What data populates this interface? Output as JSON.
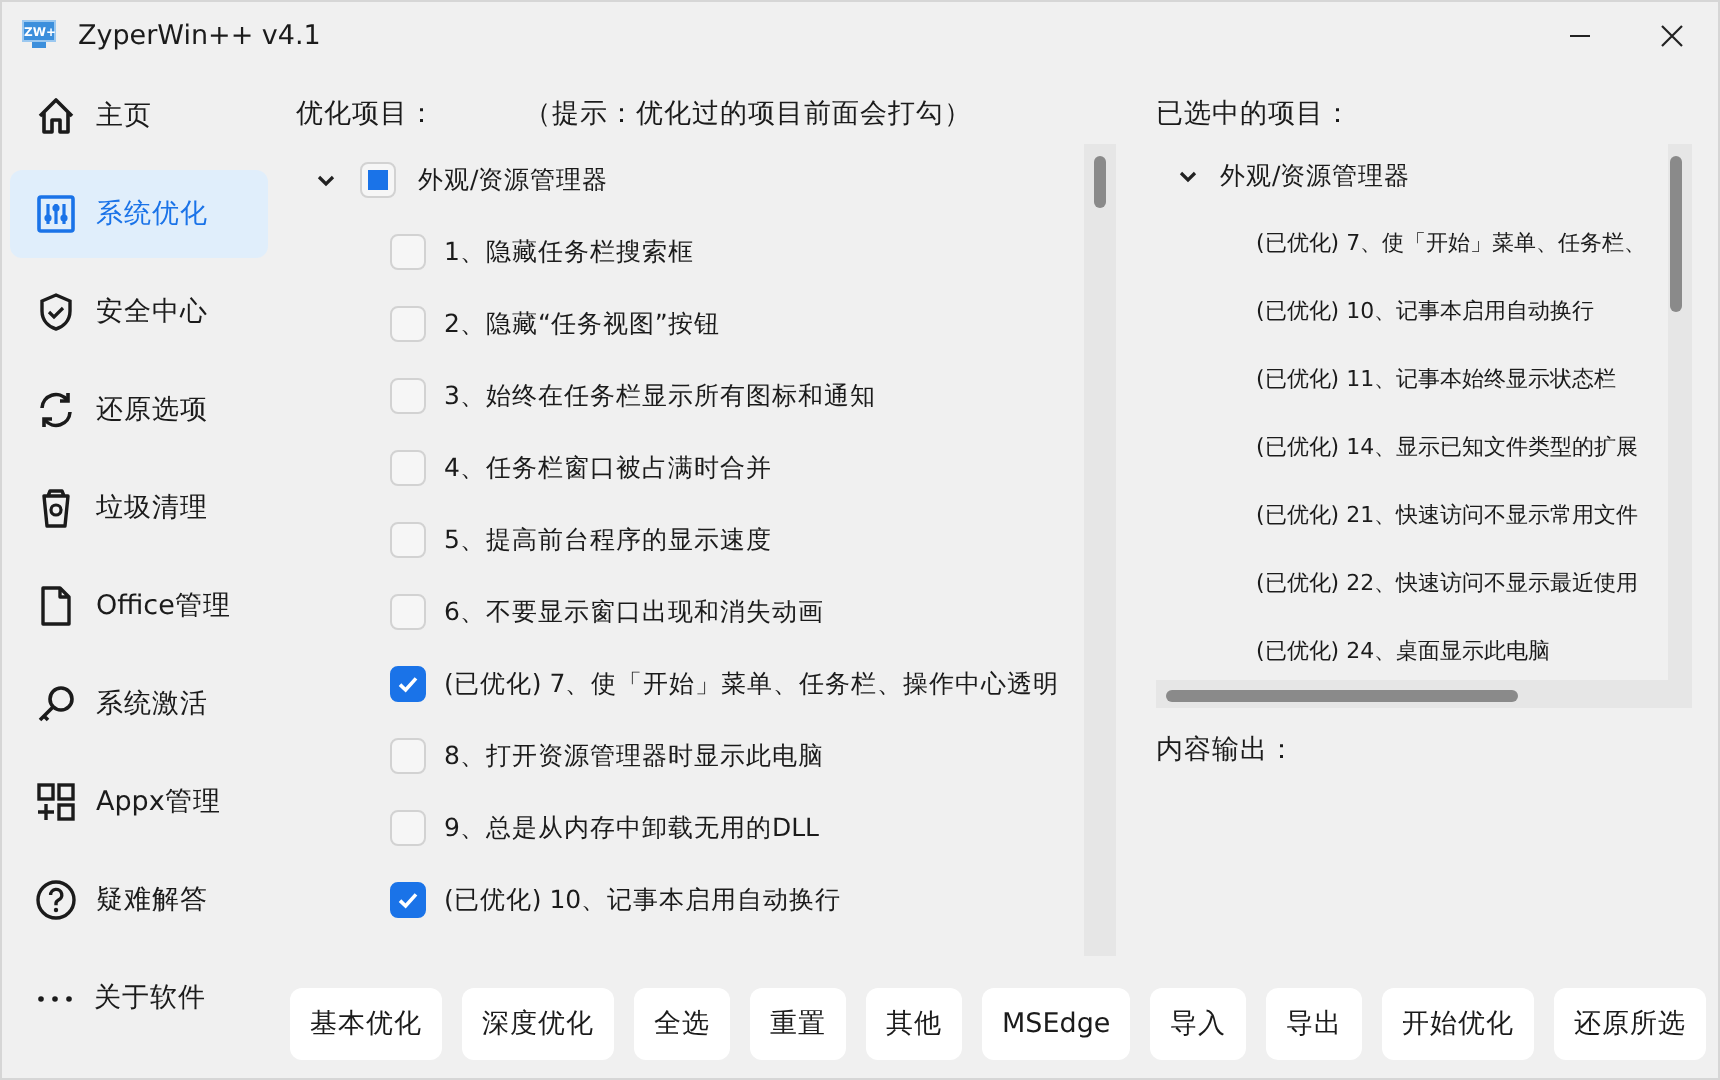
{
  "window": {
    "title": "ZyperWin++ v4.1",
    "icon_label": "ZW+"
  },
  "sidebar": {
    "items": [
      {
        "label": "主页",
        "selected": false
      },
      {
        "label": "系统优化",
        "selected": true
      },
      {
        "label": "安全中心",
        "selected": false
      },
      {
        "label": "还原选项",
        "selected": false
      },
      {
        "label": "垃圾清理",
        "selected": false
      },
      {
        "label": "Office管理",
        "selected": false
      },
      {
        "label": "系统激活",
        "selected": false
      },
      {
        "label": "Appx管理",
        "selected": false
      },
      {
        "label": "疑难解答",
        "selected": false
      },
      {
        "label": "关于软件",
        "selected": false
      }
    ]
  },
  "optimize": {
    "title": "优化项目：",
    "hint": "（提示：优化过的项目前面会打勾）",
    "tree": [
      {
        "label": "外观/资源管理器",
        "expanded": true,
        "checked": false,
        "indeterminate": true,
        "children": [
          {
            "label": "1、隐藏任务栏搜索框",
            "checked": false
          },
          {
            "label": "2、隐藏“任务视图”按钮",
            "checked": false
          },
          {
            "label": "3、始终在任务栏显示所有图标和通知",
            "checked": false
          },
          {
            "label": "4、任务栏窗口被占满时合并",
            "checked": false
          },
          {
            "label": "5、提高前台程序的显示速度",
            "checked": false
          },
          {
            "label": "6、不要显示窗口出现和消失动画",
            "checked": false
          },
          {
            "label": "(已优化) 7、使「开始」菜单、任务栏、操作中心透明",
            "checked": true
          },
          {
            "label": "8、打开资源管理器时显示此电脑",
            "checked": false
          },
          {
            "label": "9、总是从内存中卸载无用的DLL",
            "checked": false
          },
          {
            "label": "(已优化) 10、记事本启用自动换行",
            "checked": true
          }
        ]
      }
    ]
  },
  "selected_items": {
    "title": "已选中的项目：",
    "tree": [
      {
        "label": "外观/资源管理器",
        "expanded": true,
        "children": [
          {
            "label": "(已优化) 7、使「开始」菜单、任务栏、"
          },
          {
            "label": "(已优化) 10、记事本启用自动换行"
          },
          {
            "label": "(已优化) 11、记事本始终显示状态栏"
          },
          {
            "label": "(已优化) 14、显示已知文件类型的扩展"
          },
          {
            "label": "(已优化) 21、快速访问不显示常用文件"
          },
          {
            "label": "(已优化) 22、快速访问不显示最近使用"
          },
          {
            "label": "(已优化) 24、桌面显示此电脑"
          }
        ]
      }
    ]
  },
  "output": {
    "title": "内容输出："
  },
  "buttons": [
    "基本优化",
    "深度优化",
    "全选",
    "重置",
    "其他",
    "MSEdge",
    "导入",
    "导出",
    "开始优化",
    "还原所选"
  ]
}
